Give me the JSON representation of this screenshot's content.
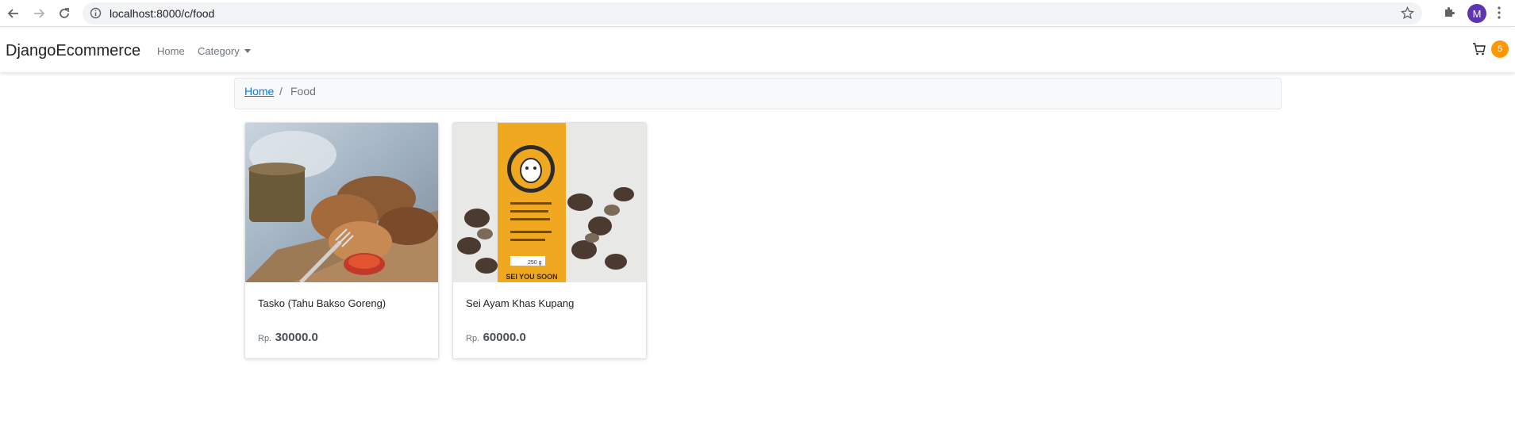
{
  "browser": {
    "url": "localhost:8000/c/food",
    "profile_initial": "M"
  },
  "navbar": {
    "brand": "DjangoEcommerce",
    "home": "Home",
    "category": "Category",
    "cart_count": "5"
  },
  "breadcrumb": {
    "home": "Home",
    "separator": "/",
    "current": "Food"
  },
  "products": [
    {
      "title": "Tasko (Tahu Bakso Goreng)",
      "currency": "Rp.",
      "price": "30000.0"
    },
    {
      "title": "Sei Ayam Khas Kupang",
      "currency": "Rp.",
      "price": "60000.0"
    }
  ],
  "product_images": {
    "package_brand": "SEI YOU SOON",
    "package_weight": "250 g"
  },
  "colors": {
    "link": "#007bff",
    "badge": "#ff9800",
    "avatar": "#5e35b1"
  }
}
